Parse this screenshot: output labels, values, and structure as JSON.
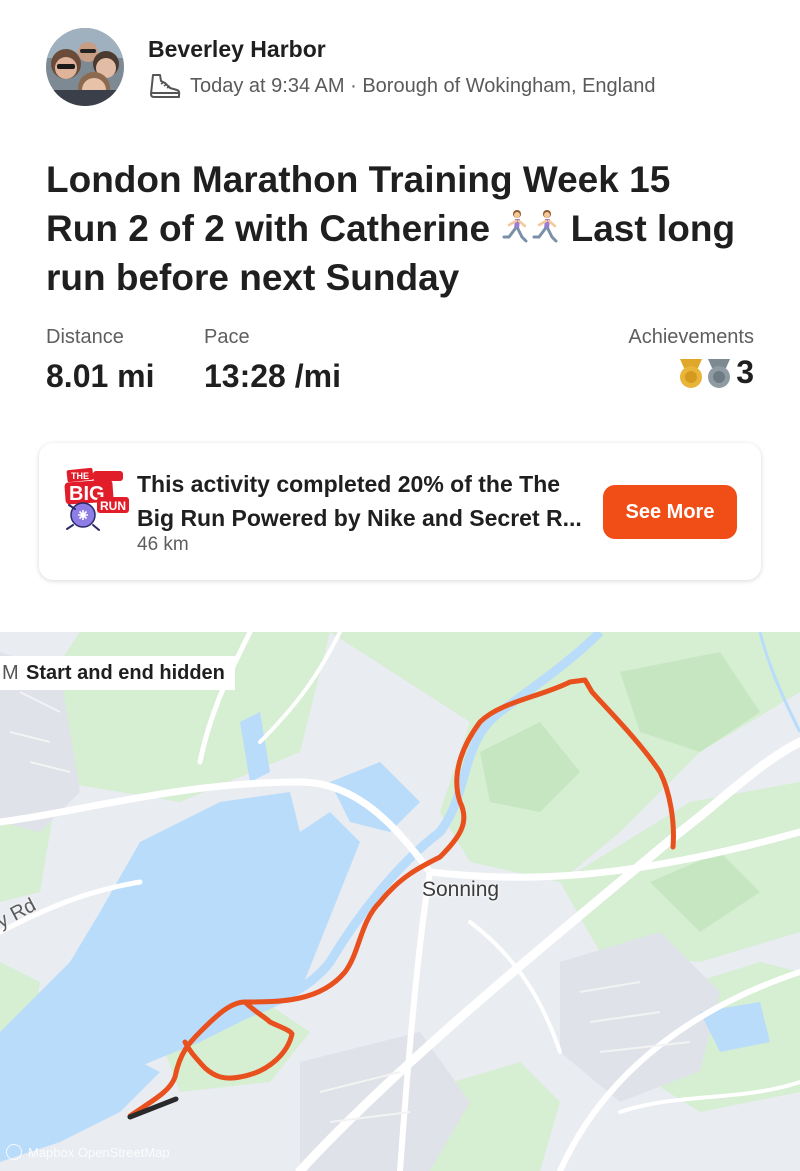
{
  "header": {
    "athlete_name": "Beverley Harbor",
    "activity_icon": "running-shoe-icon",
    "time": "Today at 9:34 AM",
    "separator": " · ",
    "location": "Borough of Wokingham, England"
  },
  "activity": {
    "title_part1": "London Marathon Training Week 15 Run 2 of 2 with Catherine ",
    "title_part2": " Last long run before next Sunday"
  },
  "stats": {
    "distance": {
      "label": "Distance",
      "value": "8.01 mi"
    },
    "pace": {
      "label": "Pace",
      "value": "13:28 /mi"
    },
    "achievements": {
      "label": "Achievements",
      "count": "3",
      "medals": [
        "gold-medal-icon",
        "silver-medal-icon"
      ]
    }
  },
  "challenge": {
    "line1": "This activity completed 20% of the The",
    "line2": "Big Run Powered by Nike and Secret R...",
    "distance": "46 km",
    "button_label": "See More",
    "logo_text_top": "THE",
    "logo_text_big": "BIG",
    "logo_text_run": "RUN",
    "progress_percent": 20
  },
  "map": {
    "privacy_label": "Start and end hidden",
    "edge_letter": "M",
    "place_label": "Sonning",
    "road_label": "ey Rd",
    "attribution": "Mapbox  OpenStreetMap"
  },
  "colors": {
    "accent": "#f04d17",
    "route": "#e8501d",
    "water": "#b9dcfb",
    "park": "#d3ecd0"
  }
}
